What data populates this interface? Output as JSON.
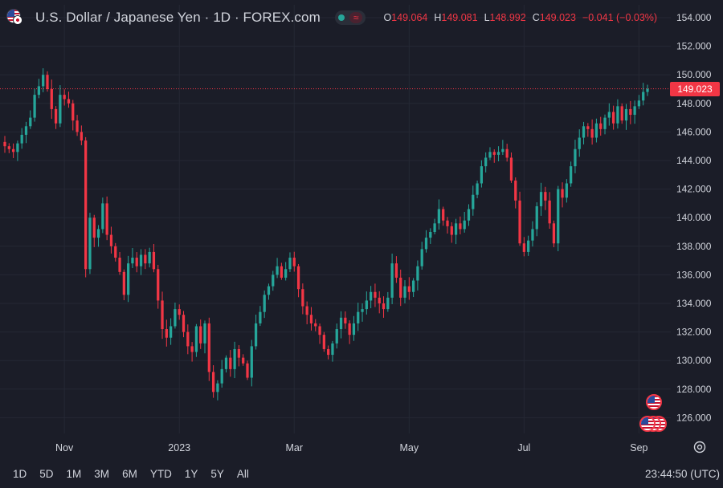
{
  "header": {
    "title": "U.S. Dollar / Japanese Yen · 1D · FOREX.com",
    "ohlc": {
      "o_label": "O",
      "o": "149.064",
      "h_label": "H",
      "h": "149.081",
      "l_label": "L",
      "l": "148.992",
      "c_label": "C",
      "c": "149.023",
      "change": "−0.041 (−0.03%)"
    },
    "wave_symbol": "≈"
  },
  "last_price_label": "149.023",
  "range_buttons": [
    "1D",
    "5D",
    "1M",
    "3M",
    "6M",
    "YTD",
    "1Y",
    "5Y",
    "All"
  ],
  "clock": "23:44:50 (UTC)",
  "colors": {
    "background": "#1b1d28",
    "grid": "#252834",
    "up": "#26a69a",
    "down": "#f23645",
    "text": "#d1d4dc"
  },
  "chart_data": {
    "type": "candlestick",
    "symbol": "USDJPY",
    "interval": "1D",
    "y_ticks": [
      "154.000",
      "152.000",
      "150.000",
      "148.000",
      "146.000",
      "144.000",
      "142.000",
      "140.000",
      "138.000",
      "136.000",
      "134.000",
      "132.000",
      "130.000",
      "128.000",
      "126.000"
    ],
    "x_ticks": [
      {
        "label": "Nov",
        "index": 14
      },
      {
        "label": "2023",
        "index": 41
      },
      {
        "label": "Mar",
        "index": 68
      },
      {
        "label": "May",
        "index": 95
      },
      {
        "label": "Jul",
        "index": 122
      },
      {
        "label": "Sep",
        "index": 149
      }
    ],
    "ylim": [
      124.5,
      155
    ],
    "last_price": 149.023,
    "close": [
      145.0,
      144.8,
      144.6,
      145.2,
      145.8,
      146.4,
      147.0,
      148.6,
      149.2,
      150.0,
      149.0,
      147.6,
      146.6,
      148.6,
      148.3,
      148.0,
      146.8,
      146.0,
      145.4,
      136.4,
      140.0,
      138.6,
      139.2,
      141.0,
      138.8,
      138.0,
      137.2,
      136.2,
      134.6,
      136.8,
      137.2,
      136.6,
      137.4,
      136.8,
      137.6,
      136.4,
      134.2,
      132.2,
      131.6,
      132.4,
      133.6,
      133.2,
      132.0,
      131.0,
      130.6,
      132.4,
      131.2,
      132.6,
      129.2,
      127.8,
      128.4,
      129.4,
      130.2,
      129.4,
      130.8,
      130.2,
      129.8,
      128.8,
      131.0,
      132.6,
      133.4,
      134.6,
      135.2,
      136.0,
      136.6,
      135.8,
      136.4,
      137.2,
      136.6,
      135.0,
      133.8,
      133.2,
      132.6,
      132.4,
      131.8,
      130.8,
      130.4,
      131.2,
      132.2,
      133.0,
      132.6,
      131.8,
      132.6,
      133.4,
      133.6,
      134.2,
      134.8,
      134.4,
      134.0,
      133.6,
      134.4,
      136.8,
      135.8,
      134.4,
      135.2,
      134.8,
      135.6,
      136.6,
      137.8,
      138.6,
      139.0,
      139.6,
      140.6,
      139.8,
      139.4,
      138.8,
      139.6,
      139.2,
      139.8,
      140.6,
      141.6,
      142.4,
      143.6,
      144.2,
      144.6,
      144.4,
      144.6,
      144.8,
      144.2,
      142.6,
      141.2,
      138.2,
      137.6,
      138.4,
      139.2,
      140.8,
      141.8,
      141.2,
      139.6,
      138.2,
      142.0,
      141.4,
      142.4,
      143.6,
      144.8,
      145.6,
      146.4,
      146.2,
      145.6,
      146.6,
      146.2,
      147.0,
      147.4,
      146.6,
      147.8,
      146.8,
      147.6,
      147.2,
      147.8,
      148.2,
      148.8,
      149.02
    ]
  }
}
